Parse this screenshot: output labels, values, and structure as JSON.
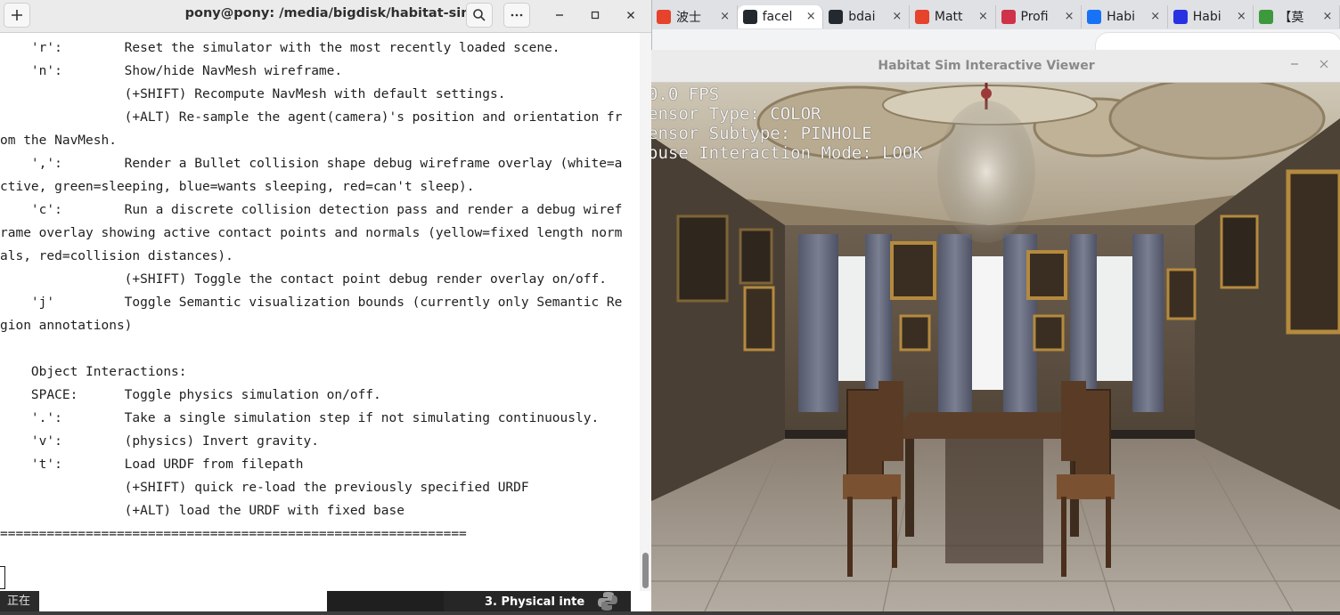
{
  "terminal": {
    "title": "pony@pony: /media/bigdisk/habitat-sim",
    "new_tab_icon": "plus-icon",
    "search_icon": "search-icon",
    "menu_icon": "ellipsis-icon",
    "minimize_icon": "minimize-icon",
    "maximize_icon": "maximize-icon",
    "close_icon": "close-icon",
    "lines": [
      "    'r':        Reset the simulator with the most recently loaded scene.",
      "    'n':        Show/hide NavMesh wireframe.",
      "                (+SHIFT) Recompute NavMesh with default settings.",
      "                (+ALT) Re-sample the agent(camera)'s position and orientation fr",
      "om the NavMesh.",
      "    ',':        Render a Bullet collision shape debug wireframe overlay (white=a",
      "ctive, green=sleeping, blue=wants sleeping, red=can't sleep).",
      "    'c':        Run a discrete collision detection pass and render a debug wiref",
      "rame overlay showing active contact points and normals (yellow=fixed length norm",
      "als, red=collision distances).",
      "                (+SHIFT) Toggle the contact point debug render overlay on/off.",
      "    'j'         Toggle Semantic visualization bounds (currently only Semantic Re",
      "gion annotations)",
      "",
      "    Object Interactions:",
      "    SPACE:      Toggle physics simulation on/off.",
      "    '.':        Take a single simulation step if not simulating continuously.",
      "    'v':        (physics) Invert gravity.",
      "    't':        Load URDF from filepath",
      "                (+SHIFT) quick re-load the previously specified URDF",
      "                (+ALT) load the URDF with fixed base",
      "============================================================"
    ]
  },
  "browser_tabs": [
    {
      "label": "波士",
      "favicon": "csdn-icon",
      "color": "#e5432b",
      "active": false
    },
    {
      "label": "facel",
      "favicon": "github-icon",
      "color": "#24292f",
      "active": true
    },
    {
      "label": "bdai",
      "favicon": "github-icon",
      "color": "#24292f",
      "active": false
    },
    {
      "label": "Matt",
      "favicon": "csdn-icon",
      "color": "#e5432b",
      "active": false
    },
    {
      "label": "Profi",
      "favicon": "profile-icon",
      "color": "#d0324a",
      "active": false
    },
    {
      "label": "Habi",
      "favicon": "zhihu-icon",
      "color": "#1772f6",
      "active": false
    },
    {
      "label": "Habi",
      "favicon": "baidu-icon",
      "color": "#2932e1",
      "active": false
    },
    {
      "label": "【莫",
      "favicon": "green-icon",
      "color": "#3c9a3c",
      "active": false
    }
  ],
  "viewer": {
    "title": "Habitat Sim Interactive Viewer",
    "overlay": [
      "0.0 FPS",
      "ensor Type: COLOR",
      "ensor Subtype: PINHOLE",
      "ouse Interaction Mode: LOOK"
    ]
  },
  "taskbar": {
    "left_text": "正在",
    "item_label": "3. Physical inte"
  }
}
